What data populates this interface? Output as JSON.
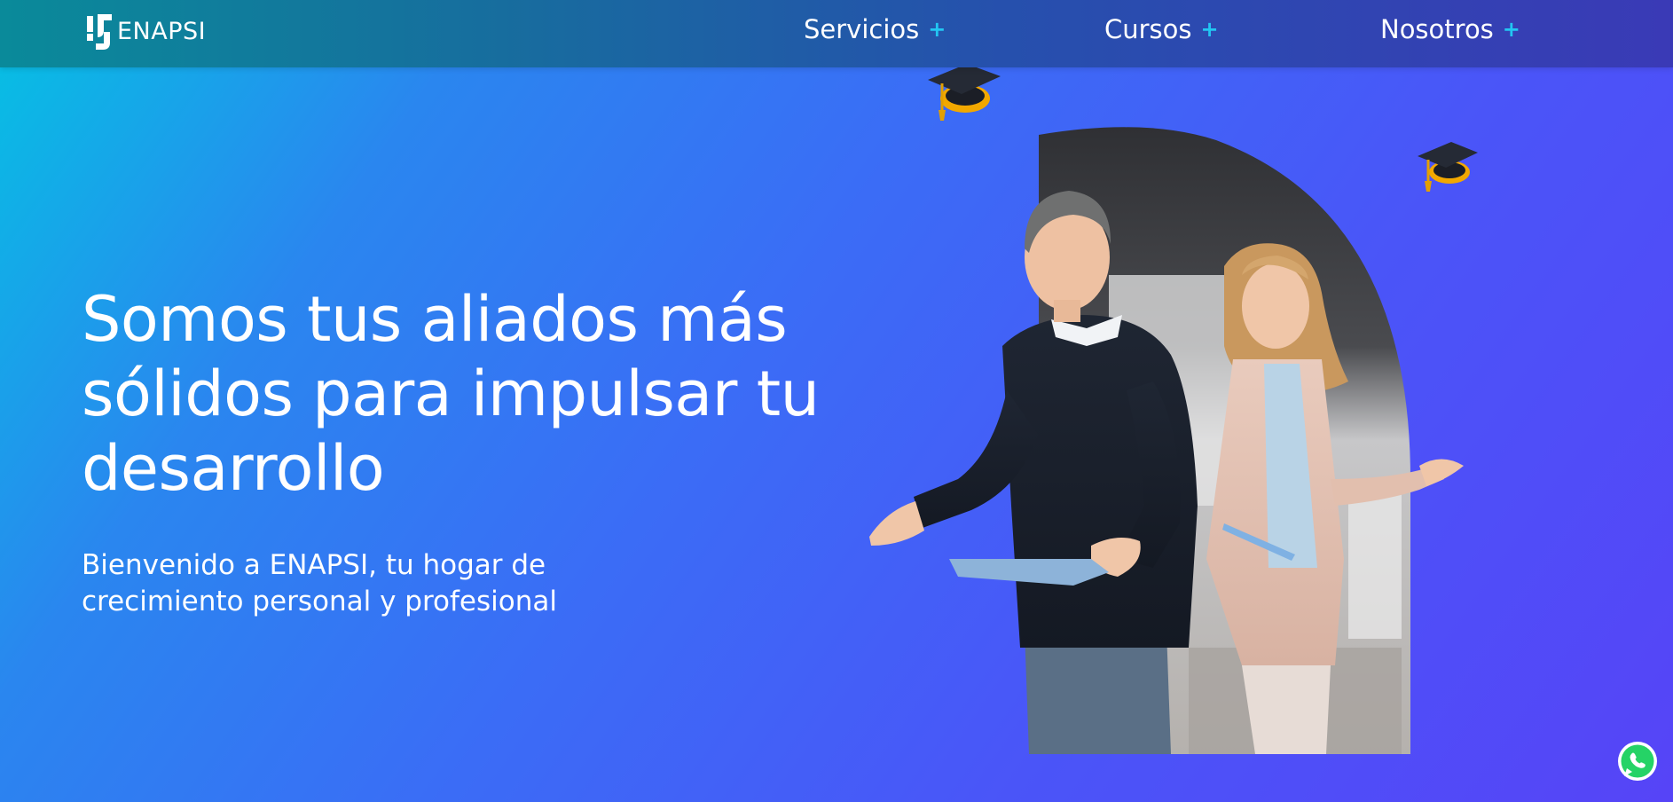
{
  "brand": {
    "name": "ENAPSI"
  },
  "nav": {
    "items": [
      {
        "label": "Servicios",
        "plus": "+"
      },
      {
        "label": "Cursos",
        "plus": "+"
      },
      {
        "label": "Nosotros",
        "plus": "+"
      }
    ]
  },
  "hero": {
    "title_lines": [
      "Somos tus aliados más",
      "sólidos para impulsar tu",
      "desarrollo"
    ],
    "subtitle_lines": [
      "Bienvenido a ENAPSI, tu hogar de",
      "crecimiento personal y profesional"
    ]
  },
  "icons": {
    "logo": "enapsi-logo-icon",
    "graduation_cap": "graduation-cap-icon",
    "whatsapp": "whatsapp-icon"
  },
  "colors": {
    "accent_plus": "#22c6f2",
    "gradient_start": "#05c2e3",
    "gradient_end": "#5644f7",
    "whatsapp_green": "#25d366"
  }
}
